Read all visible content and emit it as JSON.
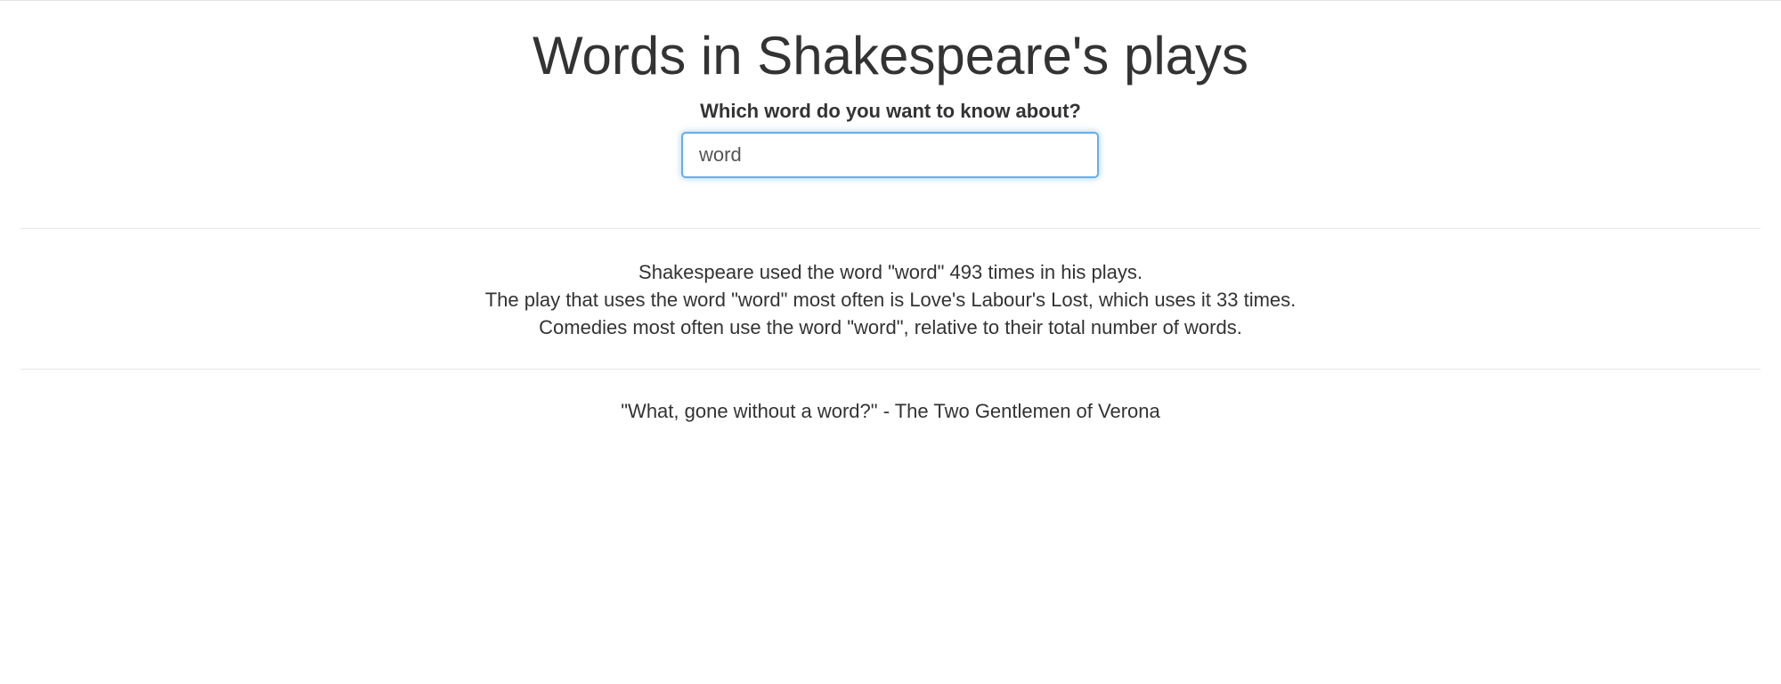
{
  "header": {
    "title": "Words in Shakespeare's plays"
  },
  "search": {
    "label": "Which word do you want to know about?",
    "value": "word",
    "placeholder": ""
  },
  "results": {
    "total_line": "Shakespeare used the word \"word\" 493 times in his plays.",
    "top_play_line": "The play that uses the word \"word\" most often is Love's Labour's Lost, which uses it 33 times.",
    "genre_line": "Comedies most often use the word \"word\", relative to their total number of words."
  },
  "quote": {
    "text": "\"What, gone without a word?\" - The Two Gentlemen of Verona"
  },
  "colors": {
    "text": "#333333",
    "input_focus_border": "#66afe9",
    "divider": "#e6e6e6"
  }
}
